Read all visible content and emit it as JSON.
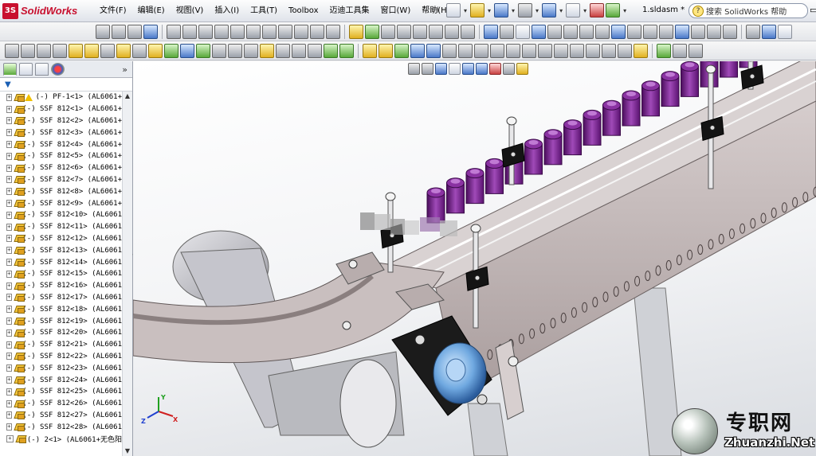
{
  "app": {
    "logo_text": "SolidWorks",
    "file_name": "1.sldasm *",
    "search_placeholder": "搜索 SolidWorks 帮助"
  },
  "menu": [
    "文件(F)",
    "编辑(E)",
    "视图(V)",
    "插入(I)",
    "工具(T)",
    "Toolbox",
    "迈迪工具集",
    "窗口(W)",
    "帮助(H)"
  ],
  "feature_tree": {
    "filter_label": "▼",
    "items": [
      {
        "name": "(-) PF-1<1> (AL6061+",
        "warning": true
      },
      {
        "name": "(-) SSF 812<1> (AL6061+"
      },
      {
        "name": "(-) SSF 812<2> (AL6061+"
      },
      {
        "name": "(-) SSF 812<3> (AL6061+"
      },
      {
        "name": "(-) SSF 812<4> (AL6061+"
      },
      {
        "name": "(-) SSF 812<5> (AL6061+"
      },
      {
        "name": "(-) SSF 812<6> (AL6061+"
      },
      {
        "name": "(-) SSF 812<7> (AL6061+"
      },
      {
        "name": "(-) SSF 812<8> (AL6061+"
      },
      {
        "name": "(-) SSF 812<9> (AL6061+"
      },
      {
        "name": "(-) SSF 812<10> (AL6061"
      },
      {
        "name": "(-) SSF 812<11> (AL6061"
      },
      {
        "name": "(-) SSF 812<12> (AL6061"
      },
      {
        "name": "(-) SSF 812<13> (AL6061"
      },
      {
        "name": "(-) SSF 812<14> (AL6061"
      },
      {
        "name": "(-) SSF 812<15> (AL6061"
      },
      {
        "name": "(-) SSF 812<16> (AL6061"
      },
      {
        "name": "(-) SSF 812<17> (AL6061"
      },
      {
        "name": "(-) SSF 812<18> (AL6061"
      },
      {
        "name": "(-) SSF 812<19> (AL6061"
      },
      {
        "name": "(-) SSF 812<20> (AL6061"
      },
      {
        "name": "(-) SSF 812<21> (AL6061"
      },
      {
        "name": "(-) SSF 812<22> (AL6061"
      },
      {
        "name": "(-) SSF 812<23> (AL6061"
      },
      {
        "name": "(-) SSF 812<24> (AL6061"
      },
      {
        "name": "(-) SSF 812<25> (AL6061"
      },
      {
        "name": "(-) SSF 812<26> (AL6061"
      },
      {
        "name": "(-) SSF 812<27> (AL6061"
      },
      {
        "name": "(-) SSF 812<28> (AL6061"
      },
      {
        "name": "(-) 2<1> (AL6061+无色阳"
      }
    ]
  },
  "triad": {
    "x": "X",
    "y": "Y",
    "z": "Z"
  },
  "watermark": {
    "cn": "专职网",
    "en": "Zhuanzhi.Net"
  },
  "colors": {
    "accent": "#c8102e",
    "bottles": "#7a1f8c",
    "frame": "#bdb3b3"
  }
}
